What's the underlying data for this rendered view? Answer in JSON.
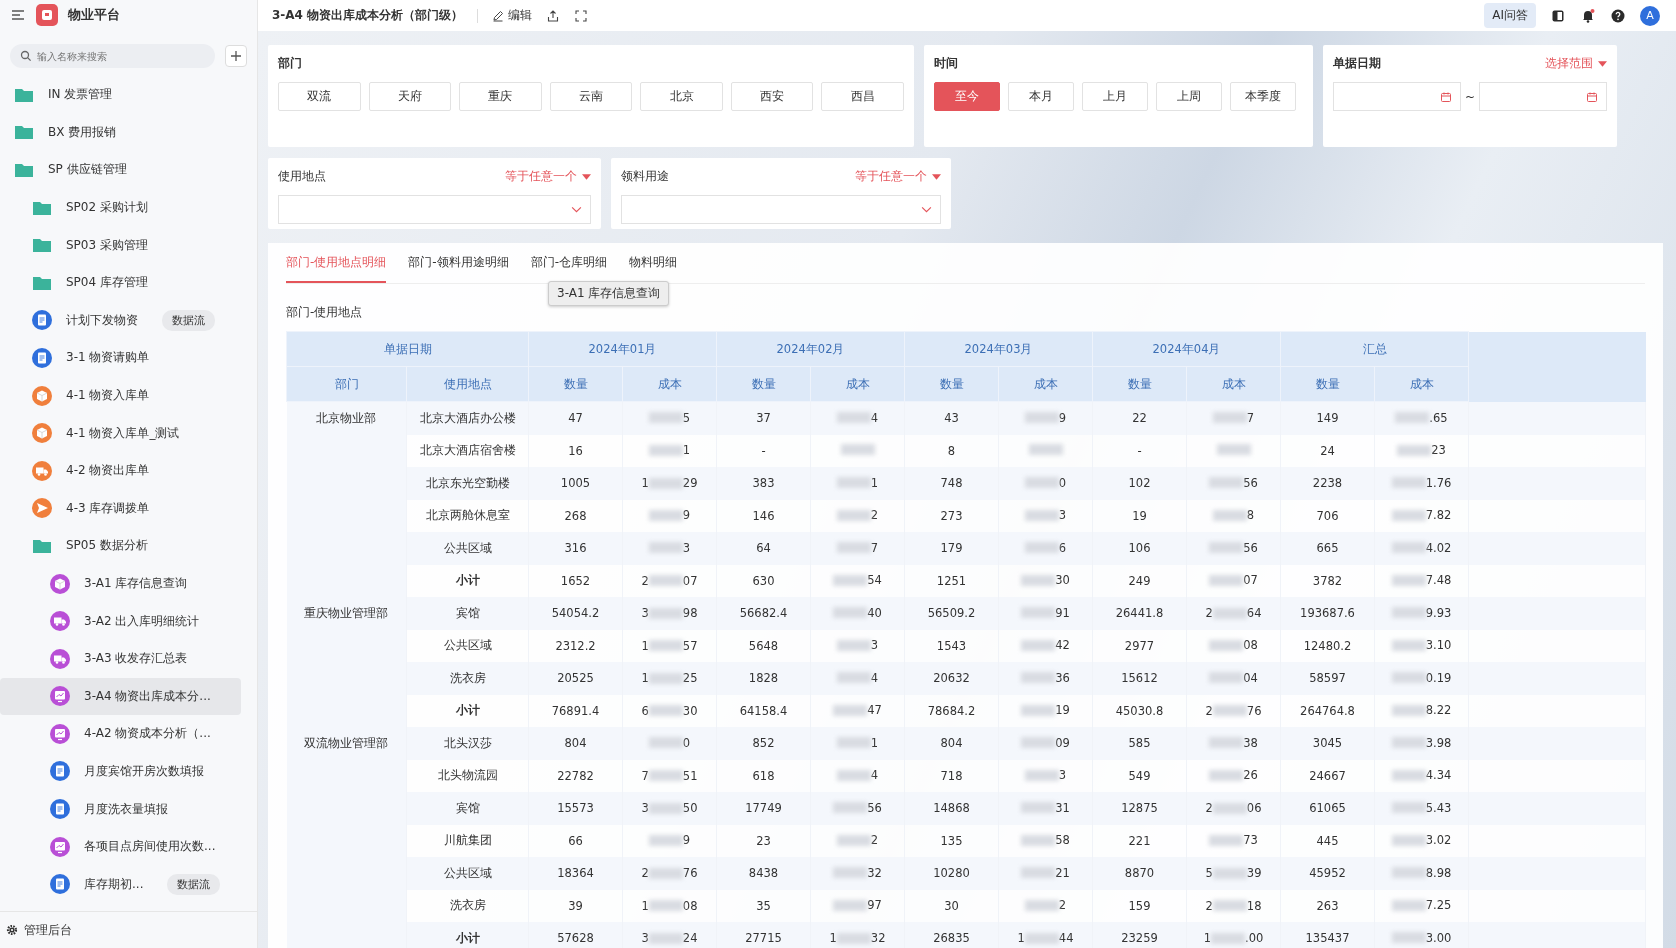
{
  "sidebar": {
    "app_name": "物业平台",
    "search": {
      "placeholder": "输入名称来搜索"
    },
    "footer": "管理后台",
    "items": [
      {
        "label": "IN 发票管理",
        "kind": "folder",
        "color": "#3bb39b",
        "selected": false
      },
      {
        "label": "BX 费用报销",
        "kind": "folder",
        "color": "#3bb39b",
        "selected": false
      },
      {
        "label": "SP 供应链管理",
        "kind": "folder",
        "color": "#3bb39b",
        "selected": false,
        "children": [
          {
            "label": "SP02 采购计划",
            "kind": "folder",
            "color": "#3bb39b",
            "selected": false
          },
          {
            "label": "SP03 采购管理",
            "kind": "folder",
            "color": "#3bb39b",
            "selected": false
          },
          {
            "label": "SP04 库存管理",
            "kind": "folder",
            "color": "#3bb39b",
            "selected": false
          },
          {
            "label": "计划下发物资",
            "kind": "doc",
            "color": "#2f6fdc",
            "selected": false,
            "badge": "数据流"
          },
          {
            "label": "3-1 物资请购单",
            "kind": "doc",
            "color": "#2f6fdc",
            "selected": false
          },
          {
            "label": "4-1 物资入库单",
            "kind": "box",
            "color": "#f07f3c",
            "selected": false
          },
          {
            "label": "4-1 物资入库单_测试",
            "kind": "box",
            "color": "#f07f3c",
            "selected": false
          },
          {
            "label": "4-2 物资出库单",
            "kind": "truck",
            "color": "#f07f3c",
            "selected": false
          },
          {
            "label": "4-3 库存调拨单",
            "kind": "send",
            "color": "#f07f3c",
            "selected": false
          },
          {
            "label": "SP05 数据分析",
            "kind": "folder",
            "color": "#3bb39b",
            "selected": false,
            "children": [
              {
                "label": "3-A1 库存信息查询",
                "kind": "box",
                "color": "#b94fd6",
                "selected": false
              },
              {
                "label": "3-A2 出入库明细统计",
                "kind": "truck",
                "color": "#b94fd6",
                "selected": false
              },
              {
                "label": "3-A3 收发存汇总表",
                "kind": "truck",
                "color": "#b94fd6",
                "selected": false
              },
              {
                "label": "3-A4 物资出库成本分...",
                "kind": "chart",
                "color": "#b94fd6",
                "selected": true
              },
              {
                "label": "4-A2 物资成本分析（...",
                "kind": "chart",
                "color": "#b94fd6",
                "selected": false
              },
              {
                "label": "月度宾馆开房次数填报",
                "kind": "doc",
                "color": "#2f6fdc",
                "selected": false
              },
              {
                "label": "月度洗衣量填报",
                "kind": "doc",
                "color": "#2f6fdc",
                "selected": false
              },
              {
                "label": "各项目点房间使用次数...",
                "kind": "chart",
                "color": "#b94fd6",
                "selected": false
              },
              {
                "label": "库存期初...",
                "kind": "doc",
                "color": "#2f6fdc",
                "selected": false,
                "badge": "数据流"
              }
            ]
          }
        ]
      }
    ]
  },
  "header": {
    "title": "3-A4 物资出库成本分析（部门级）",
    "edit": "编辑",
    "ai": "AI问答",
    "avatar": "A"
  },
  "filters": {
    "department": {
      "label": "部门",
      "options": [
        {
          "label": "双流",
          "selected": false
        },
        {
          "label": "天府",
          "selected": false
        },
        {
          "label": "重庆",
          "selected": false
        },
        {
          "label": "云南",
          "selected": false
        },
        {
          "label": "北京",
          "selected": false
        },
        {
          "label": "西安",
          "selected": false
        },
        {
          "label": "西昌",
          "selected": false
        }
      ]
    },
    "time": {
      "label": "时间",
      "options": [
        {
          "label": "至今",
          "selected": true
        },
        {
          "label": "本月",
          "selected": false
        },
        {
          "label": "上月",
          "selected": false
        },
        {
          "label": "上周",
          "selected": false
        },
        {
          "label": "本季度",
          "selected": false
        }
      ]
    },
    "date": {
      "label": "单据日期",
      "mode": "选择范围",
      "separator": "~"
    },
    "place": {
      "label": "使用地点",
      "mode": "等于任意一个"
    },
    "purpose": {
      "label": "领料用途",
      "mode": "等于任意一个"
    }
  },
  "tabs": [
    {
      "label": "部门-使用地点明细",
      "selected": true
    },
    {
      "label": "部门-领料用途明细",
      "selected": false
    },
    {
      "label": "部门-仓库明细",
      "selected": false
    },
    {
      "label": "物料明细",
      "selected": false
    }
  ],
  "tooltip": "3-A1 库存信息查询",
  "table": {
    "title": "部门-使用地点",
    "header_top": [
      "单据日期",
      "2024年01月",
      "2024年02月",
      "2024年03月",
      "2024年04月",
      "汇总"
    ],
    "header_sub": [
      "部门",
      "使用地点",
      "数量",
      "成本",
      "数量",
      "成本",
      "数量",
      "成本",
      "数量",
      "成本",
      "数量",
      "成本"
    ],
    "groups": [
      {
        "dept": "北京物业部",
        "rows": [
          {
            "place": "北京大酒店办公楼",
            "kind": "item",
            "cells": [
              {
                "qty": "47",
                "cost": {
                  "post": "5"
                }
              },
              {
                "qty": "37",
                "cost": {
                  "post": "4"
                }
              },
              {
                "qty": "43",
                "cost": {
                  "post": "9"
                }
              },
              {
                "qty": "22",
                "cost": {
                  "post": "7"
                }
              },
              {
                "qty": "149",
                "cost": {
                  "post": ".65"
                }
              }
            ]
          },
          {
            "place": "北京大酒店宿舍楼",
            "kind": "item",
            "cells": [
              {
                "qty": "16",
                "cost": {
                  "post": "1"
                }
              },
              {
                "qty": "-"
              },
              {
                "qty": "8"
              },
              {
                "qty": "-"
              },
              {
                "qty": "24",
                "cost": {
                  "post": "23"
                }
              }
            ]
          },
          {
            "place": "北京东光空勤楼",
            "kind": "item",
            "cells": [
              {
                "qty": "1005",
                "cost": {
                  "pre": "1",
                  "post": "29"
                }
              },
              {
                "qty": "383",
                "cost": {
                  "post": "1"
                }
              },
              {
                "qty": "748",
                "cost": {
                  "post": "0"
                }
              },
              {
                "qty": "102",
                "cost": {
                  "post": "56"
                }
              },
              {
                "qty": "2238",
                "cost": {
                  "post": "1.76"
                }
              }
            ]
          },
          {
            "place": "北京两舱休息室",
            "kind": "item",
            "cells": [
              {
                "qty": "268",
                "cost": {
                  "post": "9"
                }
              },
              {
                "qty": "146",
                "cost": {
                  "post": "2"
                }
              },
              {
                "qty": "273",
                "cost": {
                  "post": "3"
                }
              },
              {
                "qty": "19",
                "cost": {
                  "post": "8"
                }
              },
              {
                "qty": "706",
                "cost": {
                  "post": "7.82"
                }
              }
            ]
          },
          {
            "place": "公共区域",
            "kind": "item",
            "cells": [
              {
                "qty": "316",
                "cost": {
                  "post": "3"
                }
              },
              {
                "qty": "64",
                "cost": {
                  "post": "7"
                }
              },
              {
                "qty": "179",
                "cost": {
                  "post": "6"
                }
              },
              {
                "qty": "106",
                "cost": {
                  "post": "56"
                }
              },
              {
                "qty": "665",
                "cost": {
                  "post": "4.02"
                }
              }
            ]
          },
          {
            "place": "小计",
            "kind": "subtotal",
            "cells": [
              {
                "qty": "1652",
                "cost": {
                  "pre": "2",
                  "post": "07"
                }
              },
              {
                "qty": "630",
                "cost": {
                  "post": "54"
                }
              },
              {
                "qty": "1251",
                "cost": {
                  "post": "30"
                }
              },
              {
                "qty": "249",
                "cost": {
                  "post": "07"
                }
              },
              {
                "qty": "3782",
                "cost": {
                  "post": "7.48"
                }
              }
            ]
          }
        ]
      },
      {
        "dept": "重庆物业管理部",
        "rows": [
          {
            "place": "宾馆",
            "kind": "item",
            "cells": [
              {
                "qty": "54054.2",
                "cost": {
                  "pre": "3",
                  "post": "98"
                }
              },
              {
                "qty": "56682.4",
                "cost": {
                  "post": "40"
                }
              },
              {
                "qty": "56509.2",
                "cost": {
                  "post": "91"
                }
              },
              {
                "qty": "26441.8",
                "cost": {
                  "pre": "2",
                  "post": "64"
                }
              },
              {
                "qty": "193687.6",
                "cost": {
                  "post": "9.93"
                }
              }
            ]
          },
          {
            "place": "公共区域",
            "kind": "item",
            "cells": [
              {
                "qty": "2312.2",
                "cost": {
                  "pre": "1",
                  "post": "57"
                }
              },
              {
                "qty": "5648",
                "cost": {
                  "post": "3"
                }
              },
              {
                "qty": "1543",
                "cost": {
                  "post": "42"
                }
              },
              {
                "qty": "2977",
                "cost": {
                  "post": "08"
                }
              },
              {
                "qty": "12480.2",
                "cost": {
                  "post": "3.10"
                }
              }
            ]
          },
          {
            "place": "洗衣房",
            "kind": "item",
            "cells": [
              {
                "qty": "20525",
                "cost": {
                  "pre": "1",
                  "post": "25"
                }
              },
              {
                "qty": "1828",
                "cost": {
                  "post": "4"
                }
              },
              {
                "qty": "20632",
                "cost": {
                  "post": "36"
                }
              },
              {
                "qty": "15612",
                "cost": {
                  "post": "04"
                }
              },
              {
                "qty": "58597",
                "cost": {
                  "post": "0.19"
                }
              }
            ]
          },
          {
            "place": "小计",
            "kind": "subtotal",
            "cells": [
              {
                "qty": "76891.4",
                "cost": {
                  "pre": "6",
                  "post": "30"
                }
              },
              {
                "qty": "64158.4",
                "cost": {
                  "post": "47"
                }
              },
              {
                "qty": "78684.2",
                "cost": {
                  "post": "19"
                }
              },
              {
                "qty": "45030.8",
                "cost": {
                  "pre": "2",
                  "post": "76"
                }
              },
              {
                "qty": "264764.8",
                "cost": {
                  "post": "8.22"
                }
              }
            ]
          }
        ]
      },
      {
        "dept": "双流物业管理部",
        "rows": [
          {
            "place": "北头汉莎",
            "kind": "item",
            "cells": [
              {
                "qty": "804",
                "cost": {
                  "post": "0"
                }
              },
              {
                "qty": "852",
                "cost": {
                  "post": "1"
                }
              },
              {
                "qty": "804",
                "cost": {
                  "post": "09"
                }
              },
              {
                "qty": "585",
                "cost": {
                  "post": "38"
                }
              },
              {
                "qty": "3045",
                "cost": {
                  "post": "3.98"
                }
              }
            ]
          },
          {
            "place": "北头物流园",
            "kind": "item",
            "cells": [
              {
                "qty": "22782",
                "cost": {
                  "pre": "7",
                  "post": "51"
                }
              },
              {
                "qty": "618",
                "cost": {
                  "post": "4"
                }
              },
              {
                "qty": "718",
                "cost": {
                  "post": "3"
                }
              },
              {
                "qty": "549",
                "cost": {
                  "post": "26"
                }
              },
              {
                "qty": "24667",
                "cost": {
                  "post": "4.34"
                }
              }
            ]
          },
          {
            "place": "宾馆",
            "kind": "item",
            "cells": [
              {
                "qty": "15573",
                "cost": {
                  "pre": "3",
                  "post": "50"
                }
              },
              {
                "qty": "17749",
                "cost": {
                  "post": "56"
                }
              },
              {
                "qty": "14868",
                "cost": {
                  "post": "31"
                }
              },
              {
                "qty": "12875",
                "cost": {
                  "pre": "2",
                  "post": "06"
                }
              },
              {
                "qty": "61065",
                "cost": {
                  "post": "5.43"
                }
              }
            ]
          },
          {
            "place": "川航集团",
            "kind": "item",
            "cells": [
              {
                "qty": "66",
                "cost": {
                  "post": "9"
                }
              },
              {
                "qty": "23",
                "cost": {
                  "post": "2"
                }
              },
              {
                "qty": "135",
                "cost": {
                  "post": "58"
                }
              },
              {
                "qty": "221",
                "cost": {
                  "post": "73"
                }
              },
              {
                "qty": "445",
                "cost": {
                  "post": "3.02"
                }
              }
            ]
          },
          {
            "place": "公共区域",
            "kind": "item",
            "cells": [
              {
                "qty": "18364",
                "cost": {
                  "pre": "2",
                  "post": "76"
                }
              },
              {
                "qty": "8438",
                "cost": {
                  "post": "32"
                }
              },
              {
                "qty": "10280",
                "cost": {
                  "post": "21"
                }
              },
              {
                "qty": "8870",
                "cost": {
                  "pre": "5",
                  "post": "39"
                }
              },
              {
                "qty": "45952",
                "cost": {
                  "post": "8.98"
                }
              }
            ]
          },
          {
            "place": "洗衣房",
            "kind": "item",
            "cells": [
              {
                "qty": "39",
                "cost": {
                  "pre": "1",
                  "post": "08"
                }
              },
              {
                "qty": "35",
                "cost": {
                  "post": "97"
                }
              },
              {
                "qty": "30",
                "cost": {
                  "post": "2"
                }
              },
              {
                "qty": "159",
                "cost": {
                  "pre": "2",
                  "post": "18"
                }
              },
              {
                "qty": "263",
                "cost": {
                  "post": "7.25"
                }
              }
            ]
          },
          {
            "place": "小计",
            "kind": "subtotal",
            "cells": [
              {
                "qty": "57628",
                "cost": {
                  "pre": "3",
                  "post": "24"
                }
              },
              {
                "qty": "27715",
                "cost": {
                  "pre": "1",
                  "post": "32"
                }
              },
              {
                "qty": "26835",
                "cost": {
                  "pre": "1",
                  "post": "44"
                }
              },
              {
                "qty": "23259",
                "cost": {
                  "pre": "1",
                  "post": ".00"
                }
              },
              {
                "qty": "135437",
                "cost": {
                  "post": "3.00"
                }
              }
            ]
          }
        ]
      }
    ]
  }
}
